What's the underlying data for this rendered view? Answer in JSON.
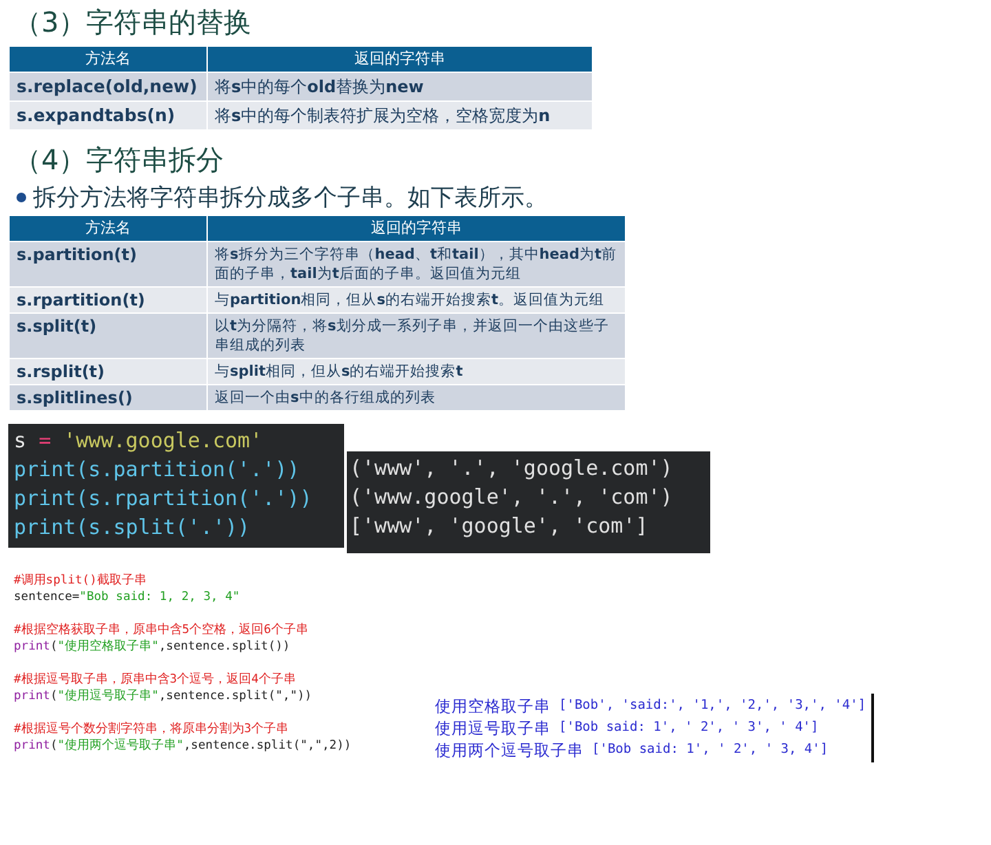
{
  "section_replace": {
    "heading": "（3）字符串的替换",
    "table": {
      "columns": [
        "方法名",
        "返回的字符串"
      ],
      "rows": [
        {
          "method": "s.replace(old,new)",
          "result": "将**s**中的每个**old**替换为**new**"
        },
        {
          "method": "s.expandtabs(n)",
          "result": "将**s**中的每个制表符扩展为空格，空格宽度为**n**"
        }
      ]
    }
  },
  "section_split": {
    "heading": "（4）字符串拆分",
    "bullet": "拆分方法将字符串拆分成多个子串。如下表所示。",
    "table": {
      "columns": [
        "方法名",
        "返回的字符串"
      ],
      "rows": [
        {
          "method": "s.partition(t)",
          "result": "将**s**拆分为三个字符串（**head**、**t**和**tail**），其中**head**为**t**前面的子串，**tail**为**t**后面的子串。返回值为元组"
        },
        {
          "method": "s.rpartition(t)",
          "result": "与**partition**相同，但从**s**的右端开始搜索**t**。返回值为元组"
        },
        {
          "method": "s.split(t)",
          "result": "以**t**为分隔符，将**s**划分成一系列子串，并返回一个由这些子串组成的列表"
        },
        {
          "method": "s.rsplit(t)",
          "result": "与**split**相同，但从**s**的右端开始搜索**t**"
        },
        {
          "method": "s.splitlines()",
          "result": "返回一个由**s**中的各行组成的列表"
        }
      ]
    }
  },
  "dark_code": {
    "lines": [
      [
        {
          "text": "s ",
          "kind": "plain"
        },
        {
          "text": "=",
          "kind": "operator"
        },
        {
          "text": " 'www.google.com'",
          "kind": "string"
        }
      ],
      [
        {
          "text": "print(s.partition('.'))",
          "kind": "call"
        }
      ],
      [
        {
          "text": "print(s.rpartition('.'))",
          "kind": "call"
        }
      ],
      [
        {
          "text": "print(s.split('.'))",
          "kind": "call"
        }
      ]
    ]
  },
  "dark_output": {
    "lines": [
      "('www', '.', 'google.com')",
      "('www.google', '.', 'com')",
      "['www', 'google', 'com']"
    ]
  },
  "light_code": {
    "blocks": [
      [
        [
          {
            "text": "#调用split()截取子串",
            "kind": "comment"
          }
        ],
        [
          {
            "text": "sentence=",
            "kind": "plain"
          },
          {
            "text": "\"Bob said: 1, 2, 3, 4\"",
            "kind": "string"
          }
        ]
      ],
      [
        [
          {
            "text": "#根据空格获取子串，原串中含5个空格，返回6个子串",
            "kind": "comment"
          }
        ],
        [
          {
            "text": "print",
            "kind": "keyword"
          },
          {
            "text": "(",
            "kind": "plain"
          },
          {
            "text": "\"使用空格取子串\"",
            "kind": "string"
          },
          {
            "text": ",sentence.split())",
            "kind": "plain"
          }
        ]
      ],
      [
        [
          {
            "text": "#根据逗号取子串，原串中含3个逗号，返回4个子串",
            "kind": "comment"
          }
        ],
        [
          {
            "text": "print",
            "kind": "keyword"
          },
          {
            "text": "(",
            "kind": "plain"
          },
          {
            "text": "\"使用逗号取子串\"",
            "kind": "string"
          },
          {
            "text": ",sentence.split(\",\"))",
            "kind": "plain"
          }
        ]
      ],
      [
        [
          {
            "text": "#根据逗号个数分割字符串，将原串分割为3个子串",
            "kind": "comment"
          }
        ],
        [
          {
            "text": "print",
            "kind": "keyword"
          },
          {
            "text": "(",
            "kind": "plain"
          },
          {
            "text": "\"使用两个逗号取子串\"",
            "kind": "string"
          },
          {
            "text": ",sentence.split(\",\",2))",
            "kind": "plain"
          }
        ]
      ]
    ]
  },
  "light_output": {
    "lines": [
      {
        "label": "使用空格取子串",
        "value": "['Bob', 'said:', '1,', '2,', '3,', '4']"
      },
      {
        "label": "使用逗号取子串",
        "value": "['Bob said: 1', ' 2', ' 3', ' 4']"
      },
      {
        "label": "使用两个逗号取子串",
        "value": "['Bob said: 1', ' 2', ' 3, 4']"
      }
    ]
  }
}
